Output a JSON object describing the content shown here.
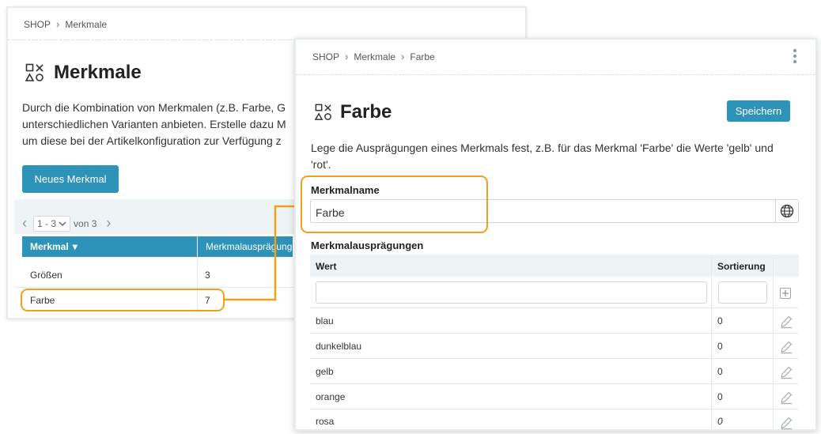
{
  "back_panel": {
    "breadcrumb": [
      "SHOP",
      "Merkmale"
    ],
    "title": "Merkmale",
    "description_lines": [
      "Durch die Kombination von Merkmalen (z.B. Farbe, G",
      "unterschiedlichen Varianten anbieten. Erstelle dazu M",
      "um diese bei der Artikelkonfiguration zur Verfügung z"
    ],
    "new_button_label": "Neues Merkmal",
    "pager": {
      "range": "1 - 3",
      "of_label": "von 3"
    },
    "table": {
      "columns": [
        "Merkmal",
        "Merkmalausprägungen"
      ],
      "sort_indicator": "▾",
      "rows": [
        {
          "name": "Größen",
          "count": "3"
        },
        {
          "name": "Farbe",
          "count": "7"
        }
      ]
    }
  },
  "front_panel": {
    "breadcrumb": [
      "SHOP",
      "Merkmale",
      "Farbe"
    ],
    "title": "Farbe",
    "save_label": "Speichern",
    "description_lines": [
      "Lege die Ausprägungen eines Merkmals fest, z.B. für das Merkmal 'Farbe' die Werte 'gelb' und",
      "'rot'."
    ],
    "name_label": "Merkmalname",
    "name_value": "Farbe",
    "values_label": "Merkmalausprägungen",
    "values_table": {
      "columns": [
        "Wert",
        "Sortierung"
      ],
      "new_value_placeholder": "",
      "new_sort_placeholder": "",
      "rows": [
        {
          "value": "blau",
          "sort": "0"
        },
        {
          "value": "dunkelblau",
          "sort": "0"
        },
        {
          "value": "gelb",
          "sort": "0"
        },
        {
          "value": "orange",
          "sort": "0"
        },
        {
          "value": "rosa",
          "sort": "0"
        }
      ]
    }
  },
  "icons": [
    "attribute-icon",
    "chevron-right-icon",
    "chevron-left-icon",
    "chevron-down-icon",
    "globe-icon",
    "plus-icon",
    "pencil-icon",
    "more-vertical-icon"
  ],
  "colors": {
    "accent": "#2e93b9",
    "highlight": "#f0a11c",
    "table_header_bg": "#eef3f6"
  }
}
